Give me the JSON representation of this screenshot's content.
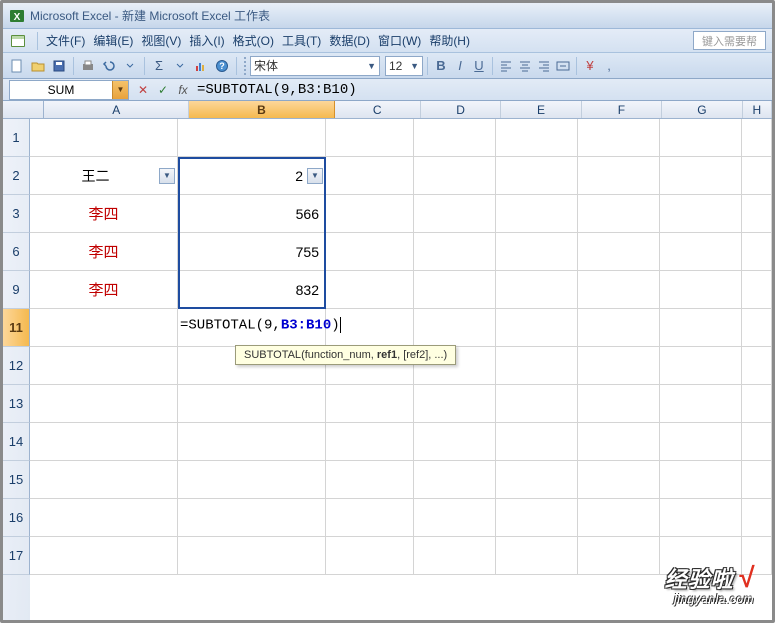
{
  "title": "Microsoft Excel - 新建 Microsoft Excel 工作表",
  "menu": {
    "file": "文件(F)",
    "edit": "编辑(E)",
    "view": "视图(V)",
    "insert": "插入(I)",
    "format": "格式(O)",
    "tools": "工具(T)",
    "data": "数据(D)",
    "window": "窗口(W)",
    "help": "帮助(H)",
    "help_placeholder": "键入需要帮"
  },
  "toolbar": {
    "font_name": "宋体",
    "font_size": "12"
  },
  "name_box": "SUM",
  "formula": "=SUBTOTAL(9,B3:B10)",
  "columns": [
    "A",
    "B",
    "C",
    "D",
    "E",
    "F",
    "G",
    "H"
  ],
  "rows": [
    "1",
    "2",
    "3",
    "6",
    "9",
    "11",
    "12",
    "13",
    "14",
    "15",
    "16",
    "17"
  ],
  "active_row": "11",
  "cells": {
    "A2": "王二",
    "B2": "2",
    "A3": "李四",
    "B3": "566",
    "A6": "李四",
    "B6": "755",
    "A9": "李四",
    "B9": "832",
    "B11_formula_prefix": "=SUBTOTAL(9,",
    "B11_formula_ref": "B3:B10",
    "B11_formula_suffix": ")"
  },
  "tooltip": {
    "fn": "SUBTOTAL",
    "args_prefix": "(function_num, ",
    "args_bold": "ref1",
    "args_suffix": ", [ref2], ...)"
  },
  "watermark": {
    "main": "经验啦",
    "check": "√",
    "sub": "jingyanla.com"
  }
}
